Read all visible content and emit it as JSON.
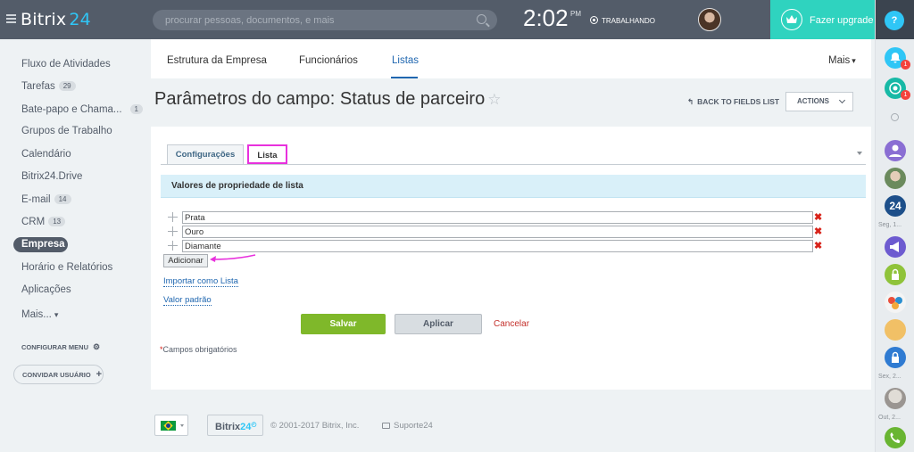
{
  "header": {
    "logo_name": "Bitrix",
    "logo_num": "24",
    "search_placeholder": "procurar pessoas, documentos, e mais",
    "clock": "2:02",
    "clock_ampm": "PM",
    "work_status": "TRABALHANDO",
    "upgrade_label": "Fazer upgrade"
  },
  "sidebar": {
    "items": [
      {
        "label": "Fluxo de Atividades",
        "counter": ""
      },
      {
        "label": "Tarefas",
        "counter": "29"
      },
      {
        "label": "Bate-papo e Chama...",
        "counter": "1"
      },
      {
        "label": "Grupos de Trabalho",
        "counter": ""
      },
      {
        "label": "Calendário",
        "counter": ""
      },
      {
        "label": "Bitrix24.Drive",
        "counter": ""
      },
      {
        "label": "E-mail",
        "counter": "14"
      },
      {
        "label": "CRM",
        "counter": "13"
      },
      {
        "label": "Empresa",
        "counter": ""
      },
      {
        "label": "Horário e Relatórios",
        "counter": ""
      },
      {
        "label": "Aplicações",
        "counter": ""
      },
      {
        "label": "Mais...",
        "counter": ""
      }
    ],
    "config_menu": "CONFIGURAR MENU",
    "invite_user": "CONVIDAR USUÁRIO"
  },
  "top_tabs": {
    "items": [
      "Estrutura da Empresa",
      "Funcionários",
      "Listas"
    ],
    "active": "Listas",
    "more": "Mais"
  },
  "page": {
    "title": "Parâmetros do campo: Status de parceiro",
    "back_link": "BACK TO FIELDS LIST",
    "actions": "ACTIONS"
  },
  "form": {
    "subtabs": [
      "Configurações",
      "Lista"
    ],
    "section_title": "Valores de propriedade de lista",
    "values": [
      "Prata",
      "Ouro",
      "Diamante"
    ],
    "add_button": "Adicionar",
    "import_link": "Importar como Lista",
    "default_link": "Valor padrão",
    "save": "Salvar",
    "apply": "Aplicar",
    "cancel": "Cancelar",
    "required_asterisk": "*",
    "required_note": "Campos obrigatórios"
  },
  "right_panel": {
    "help": "?",
    "badge_notif": "1",
    "badge_chat": "1",
    "label_1": "Seg, 1...",
    "label_2": "Sex, 2...",
    "label_3": "Out, 2...",
    "item_24": "24"
  },
  "footer": {
    "logo_name": "Bitrix",
    "logo_num": "24",
    "copyright": "© 2001-2017 Bitrix, Inc.",
    "support": "Suporte24"
  },
  "colors": {
    "header_bg": "#535c69",
    "accent": "#2fc6f6",
    "upgrade_bg": "#2fd3bf",
    "save_green": "#7fb82a",
    "annotation_magenta": "#e831dd"
  }
}
